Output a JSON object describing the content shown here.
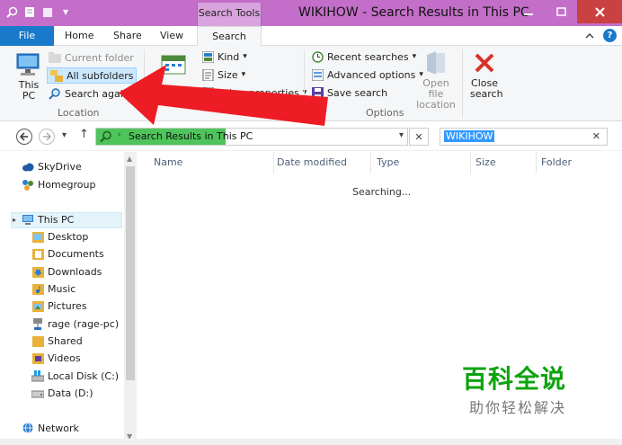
{
  "window": {
    "title": "WIKIHOW - Search Results in This PC",
    "contextual_tab": "Search Tools"
  },
  "ribbon_tabs": {
    "file": "File",
    "home": "Home",
    "share": "Share",
    "view": "View",
    "search": "Search"
  },
  "ribbon": {
    "this_pc": "This PC",
    "current_folder": "Current folder",
    "all_subfolders": "All subfolders",
    "search_again": "Search again",
    "location_group": "Location",
    "kind": "Kind",
    "size": "Size",
    "other_properties": "Other properties",
    "date_modified_partial": "dified",
    "recent_searches": "Recent searches",
    "advanced_options": "Advanced options",
    "save_search": "Save search",
    "open_file_location": "Open file location",
    "options_group": "Options",
    "close_search": "Close search"
  },
  "address": {
    "path": "Search Results in This PC",
    "search_query": "WIKIHOW"
  },
  "nav": {
    "skydrive": "SkyDrive",
    "homegroup": "Homegroup",
    "this_pc": "This PC",
    "desktop": "Desktop",
    "documents": "Documents",
    "downloads": "Downloads",
    "music": "Music",
    "pictures": "Pictures",
    "rage": "rage (rage-pc)",
    "shared": "Shared",
    "videos": "Videos",
    "local_disk": "Local Disk (C:)",
    "data": "Data (D:)",
    "network": "Network"
  },
  "columns": {
    "name": "Name",
    "date_modified": "Date modified",
    "type": "Type",
    "size": "Size",
    "folder": "Folder"
  },
  "status": {
    "searching": "Searching..."
  },
  "watermark": {
    "title": "百科全说",
    "subtitle": "助你轻松解决"
  },
  "colors": {
    "titlebar": "#c36fc9",
    "accent": "#1979ca",
    "address_fill": "#4ec45a",
    "arrow": "#ee1c24",
    "watermark": "#0da30d"
  }
}
